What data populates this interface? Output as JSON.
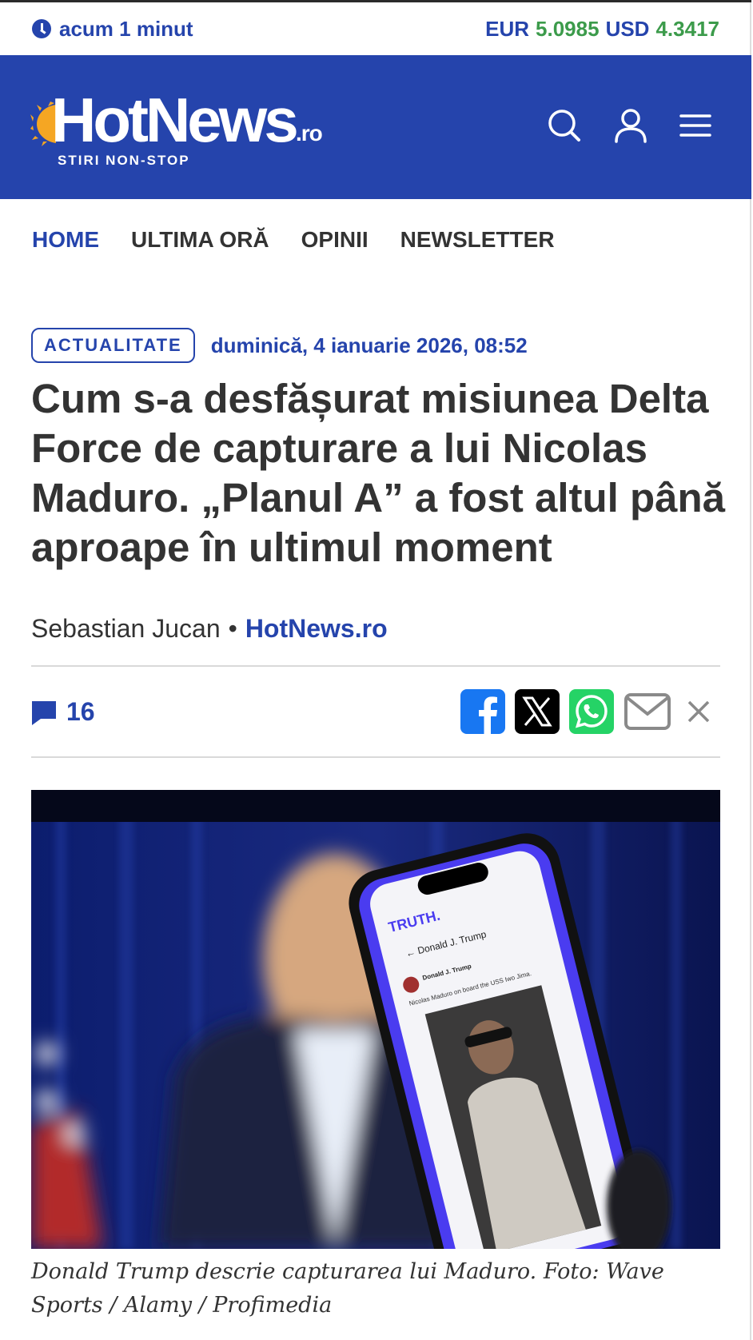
{
  "ticker": {
    "time_label": "acum 1 minut",
    "eur_label": "EUR",
    "eur_value": "5.0985",
    "usd_label": "USD",
    "usd_value": "4.3417"
  },
  "header": {
    "logo_word": "HotNews",
    "logo_tld": ".ro",
    "logo_tagline": "STIRI NON-STOP",
    "brand_color": "#2544ac"
  },
  "nav": {
    "items": [
      {
        "label": "HOME",
        "active": true
      },
      {
        "label": "ULTIMA ORĂ",
        "active": false
      },
      {
        "label": "OPINII",
        "active": false
      },
      {
        "label": "NEWSLETTER",
        "active": false
      }
    ]
  },
  "article": {
    "category": "ACTUALITATE",
    "date": "duminică, 4 ianuarie 2026, 08:52",
    "headline": "Cum s-a desfășurat misiunea Delta Force de capturare a lui Nicolas Maduro. „Planul A” a fost altul până aproape în ultimul moment",
    "author": "Sebastian Jucan",
    "separator": "•",
    "source": "HotNews.ro",
    "comment_count": "16",
    "caption": "Donald Trump descrie capturarea lui Maduro. Foto: Wave Sports / Alamy / Profimedia"
  },
  "share": {
    "icons": [
      "facebook-icon",
      "x-icon",
      "whatsapp-icon",
      "email-icon",
      "close-icon"
    ],
    "facebook_color": "#1877f2",
    "whatsapp_color": "#25d366"
  },
  "hero_image": {
    "phone_app_name": "TRUTH.",
    "phone_profile": "Donald J. Trump",
    "phone_post_text": "Nicolas Maduro on board the USS Iwo Jima."
  }
}
